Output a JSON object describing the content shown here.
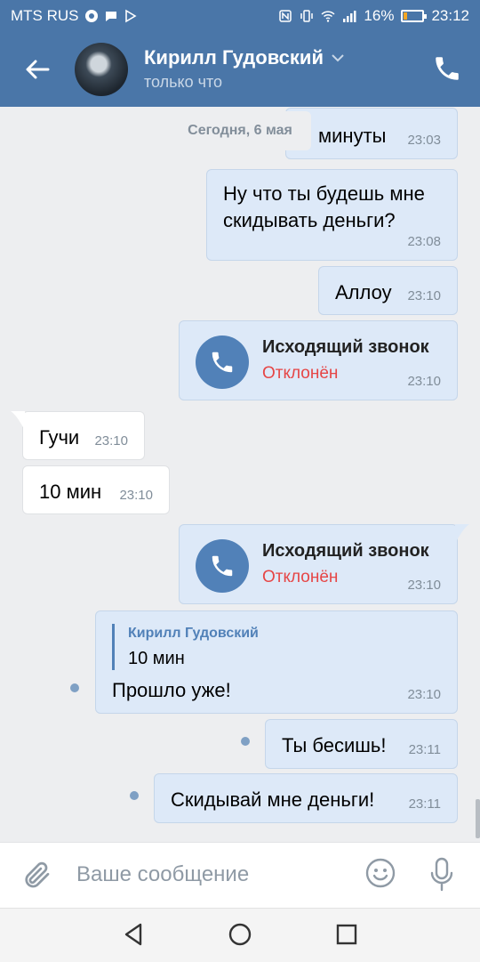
{
  "status": {
    "carrier": "MTS RUS",
    "battery": "16%",
    "time": "23:12"
  },
  "header": {
    "name": "Кирилл Гудовский",
    "subtitle": "только что"
  },
  "date_chip": "Сегодня, 6 мая",
  "messages": [
    {
      "text": "минуты",
      "time": "23:03"
    },
    {
      "text": "Ну что ты будешь мне\nскидывать деньги?",
      "time": "23:08"
    },
    {
      "text": "Аллоу",
      "time": "23:10"
    },
    {
      "title": "Исходящий звонок",
      "status": "Отклонён",
      "time": "23:10"
    },
    {
      "text": "Гучи",
      "time": "23:10"
    },
    {
      "text": "10 мин",
      "time": "23:10"
    },
    {
      "title": "Исходящий звонок",
      "status": "Отклонён",
      "time": "23:10"
    },
    {
      "reply_name": "Кирилл Гудовский",
      "reply_text": "10 мин",
      "text": "Прошло уже!",
      "time": "23:10"
    },
    {
      "text": "Ты бесишь!",
      "time": "23:11"
    },
    {
      "text": "Скидывай мне деньги!",
      "time": "23:11"
    }
  ],
  "input": {
    "placeholder": "Ваше сообщение"
  },
  "icons": {
    "back": "back-arrow-icon",
    "call": "phone-icon",
    "attach": "paperclip-icon",
    "emoji": "smile-icon",
    "mic": "microphone-icon"
  },
  "colors": {
    "accent": "#4a76a8",
    "outgoing_bubble": "#dde9f8",
    "declined": "#e64646"
  }
}
